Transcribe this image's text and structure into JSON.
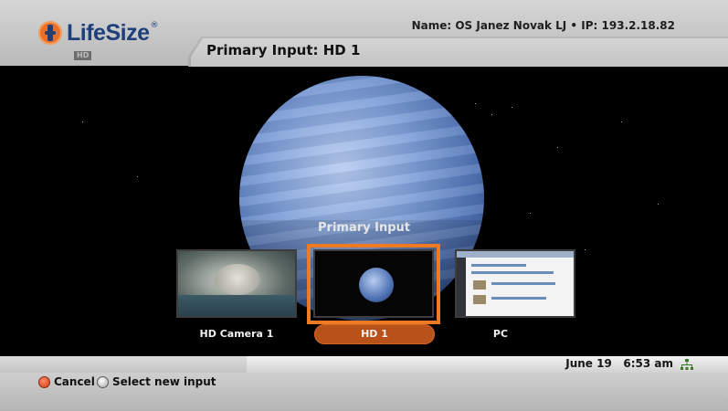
{
  "brand": {
    "name": "LifeSize",
    "registered": "®",
    "badge": "HD"
  },
  "header": {
    "system_info": "Name: OS Janez Novak LJ • IP: 193.2.18.82",
    "page_title": "Primary Input: HD 1"
  },
  "selector": {
    "title": "Primary Input",
    "selected_index": 1,
    "inputs": [
      {
        "label": "HD Camera 1",
        "preview": "cat"
      },
      {
        "label": "HD 1",
        "preview": "planet"
      },
      {
        "label": "PC",
        "preview": "desktop"
      }
    ]
  },
  "status": {
    "date": "June 19",
    "time": "6:53 am",
    "network_icon": "network-icon"
  },
  "hints": [
    {
      "button": "red",
      "label": "Cancel"
    },
    {
      "button": "ok",
      "label": "Select new input"
    }
  ],
  "colors": {
    "accent": "#ef7a23",
    "pill": "#b9521a",
    "brand": "#1d3f7a"
  }
}
